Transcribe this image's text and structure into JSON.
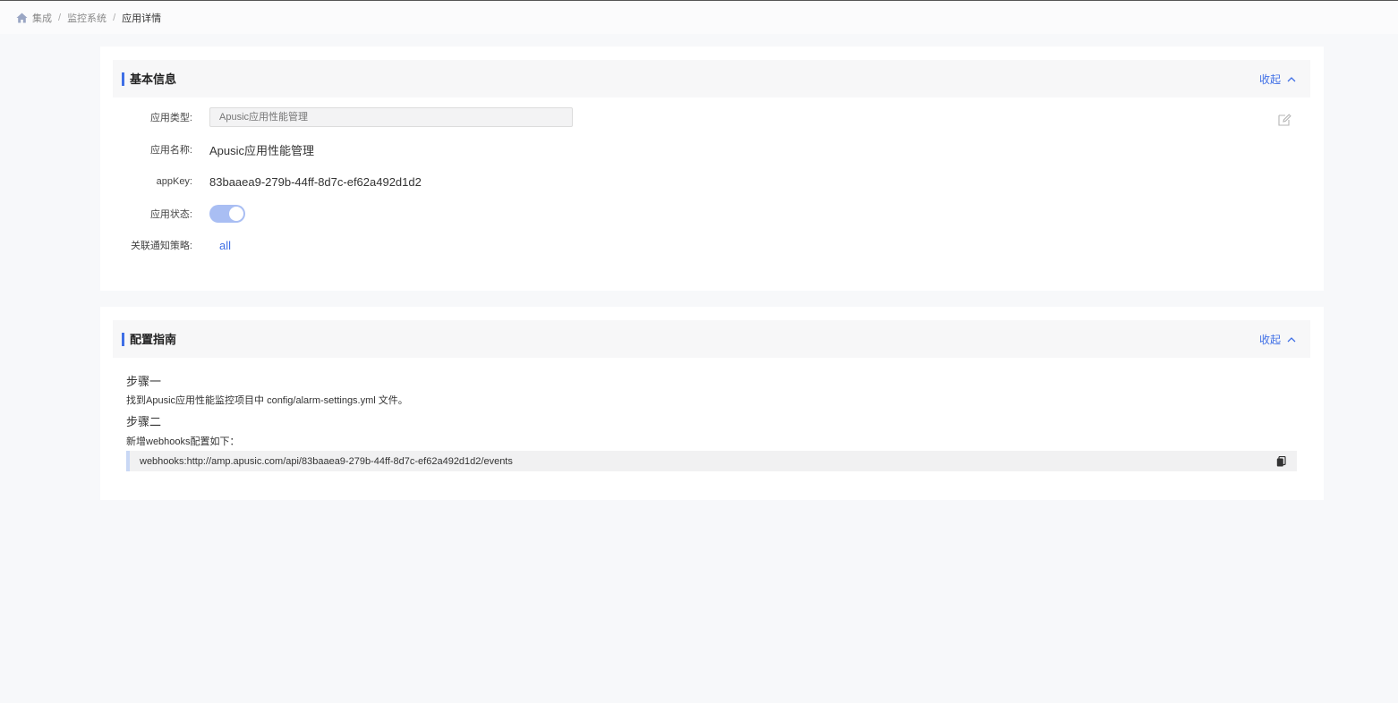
{
  "breadcrumb": {
    "items": [
      "集成",
      "监控系统",
      "应用详情"
    ],
    "separator": "/"
  },
  "basic_info": {
    "title": "基本信息",
    "collapse_label": "收起",
    "fields": {
      "type_label": "应用类型:",
      "type_placeholder": "Apusic应用性能管理",
      "name_label": "应用名称:",
      "name_value": "Apusic应用性能管理",
      "appkey_label": "appKey:",
      "appkey_value": "83baaea9-279b-44ff-8d7c-ef62a492d1d2",
      "status_label": "应用状态:",
      "status_on": true,
      "policy_label": "关联通知策略:",
      "policy_value": "all"
    }
  },
  "guide": {
    "title": "配置指南",
    "collapse_label": "收起",
    "step1_title": "步骤一",
    "step1_text": "找到Apusic应用性能监控项目中 config/alarm-settings.yml 文件。",
    "step2_title": "步骤二",
    "step2_text": "新增webhooks配置如下：",
    "code": "webhooks:http://amp.apusic.com/api/83baaea9-279b-44ff-8d7c-ef62a492d1d2/events"
  },
  "colors": {
    "accent": "#3f6fe6",
    "toggle_on": "#a9bef3",
    "background": "#f7f8fa"
  },
  "icons": [
    "home-icon",
    "chevron-up-icon",
    "edit-icon",
    "copy-icon"
  ]
}
